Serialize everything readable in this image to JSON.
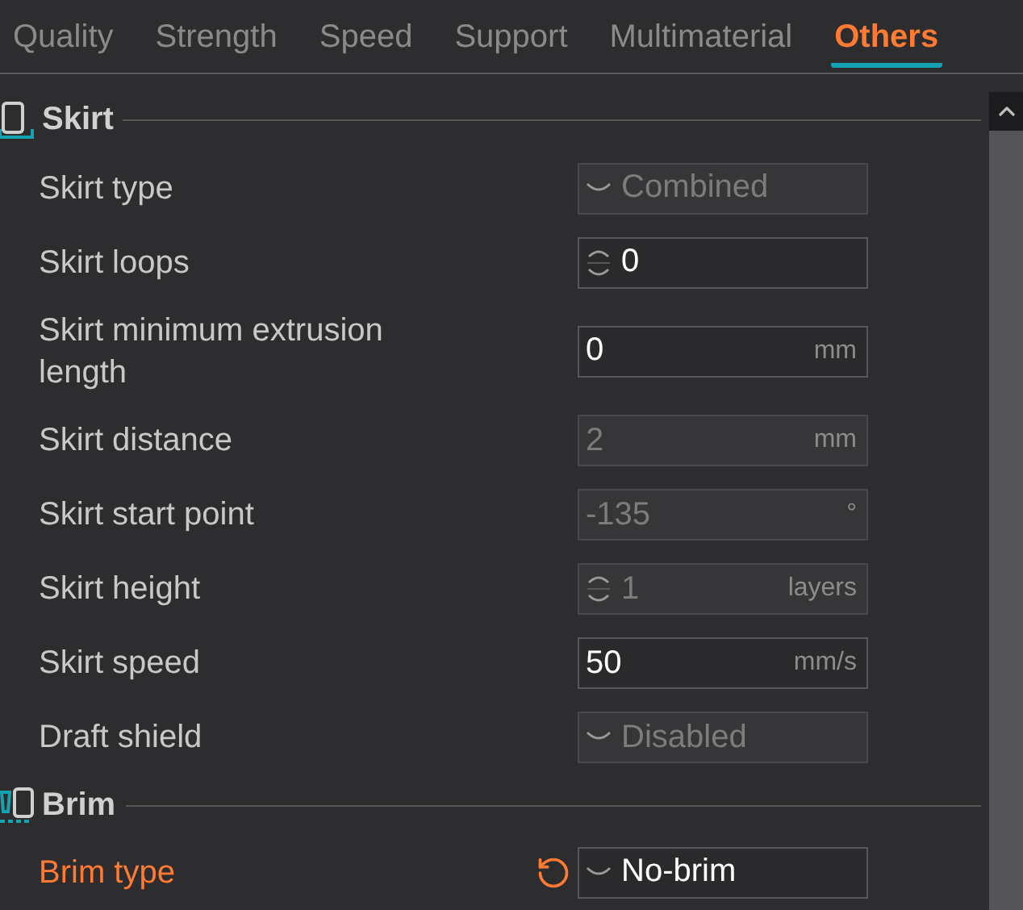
{
  "tabs": [
    {
      "label": "Quality",
      "selected": false
    },
    {
      "label": "Strength",
      "selected": false
    },
    {
      "label": "Speed",
      "selected": false
    },
    {
      "label": "Support",
      "selected": false
    },
    {
      "label": "Multimaterial",
      "selected": false
    },
    {
      "label": "Others",
      "selected": true
    }
  ],
  "sections": [
    {
      "title": "Skirt",
      "kind": "skirt",
      "rows": [
        {
          "label": "Skirt type",
          "kind": "dropdown",
          "value": "Combined",
          "disabled": true,
          "modified": false
        },
        {
          "label": "Skirt loops",
          "kind": "spinner",
          "value": "0",
          "disabled": false,
          "modified": false
        },
        {
          "label": "Skirt minimum extrusion length",
          "kind": "number",
          "value": "0",
          "unit": "mm",
          "disabled": false,
          "modified": false
        },
        {
          "label": "Skirt distance",
          "kind": "number",
          "value": "2",
          "unit": "mm",
          "disabled": true,
          "modified": false
        },
        {
          "label": "Skirt start point",
          "kind": "number",
          "value": "-135",
          "unit": "°",
          "disabled": true,
          "modified": false
        },
        {
          "label": "Skirt height",
          "kind": "spinner",
          "value": "1",
          "unit": "layers",
          "disabled": true,
          "modified": false
        },
        {
          "label": "Skirt speed",
          "kind": "number",
          "value": "50",
          "unit": "mm/s",
          "disabled": false,
          "modified": false
        },
        {
          "label": "Draft shield",
          "kind": "dropdown",
          "value": "Disabled",
          "disabled": true,
          "modified": false
        }
      ]
    },
    {
      "title": "Brim",
      "kind": "brim",
      "rows": [
        {
          "label": "Brim type",
          "kind": "dropdown",
          "value": "No-brim",
          "disabled": false,
          "modified": true
        }
      ]
    }
  ]
}
